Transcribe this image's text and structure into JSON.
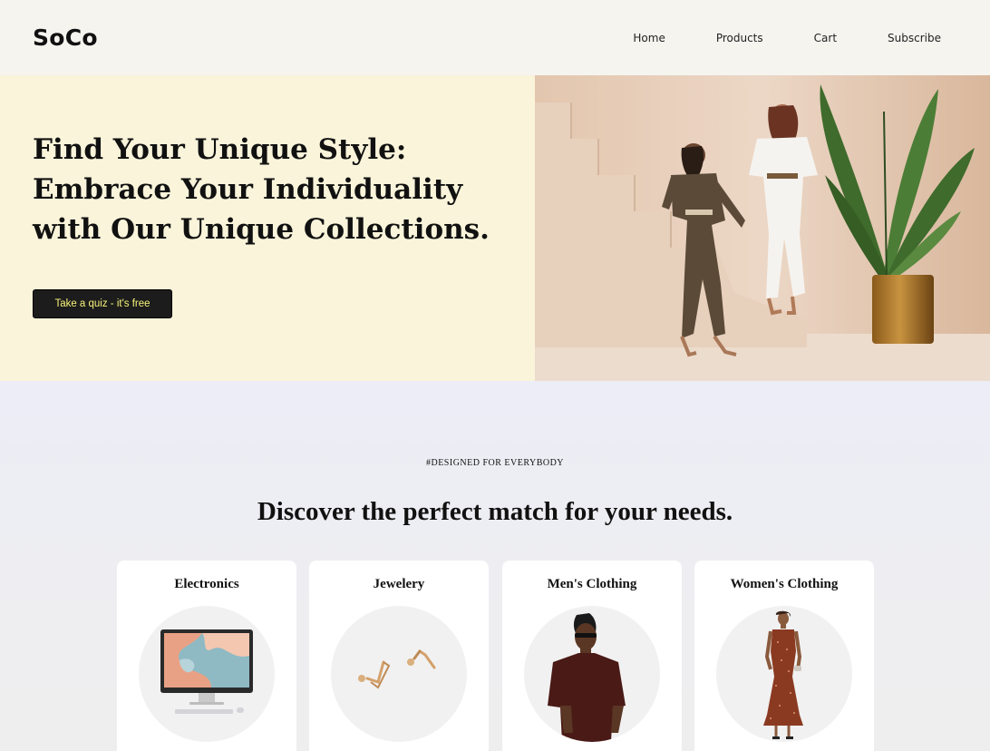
{
  "header": {
    "logo": "SoCo",
    "nav": [
      "Home",
      "Products",
      "Cart",
      "Subscribe"
    ]
  },
  "hero": {
    "title": "Find Your Unique Style: Embrace Your Individuality with Our Unique Collections.",
    "cta_label": "Take a quiz - it's free"
  },
  "section": {
    "tag": "#DESIGNED FOR EVERYBODY",
    "title": "Discover the perfect match for your needs.",
    "categories": [
      {
        "label": "Electronics",
        "icon": "monitor-icon"
      },
      {
        "label": "Jewelery",
        "icon": "earrings-icon"
      },
      {
        "label": "Men's Clothing",
        "icon": "man-tshirt-icon"
      },
      {
        "label": "Women's Clothing",
        "icon": "woman-dress-icon"
      }
    ]
  },
  "colors": {
    "header_bg": "#f5f4ef",
    "hero_bg": "#f9f4da",
    "button_bg": "#1c1c1c",
    "button_text": "#f6f27a",
    "section_bg": "#ecedf2"
  }
}
